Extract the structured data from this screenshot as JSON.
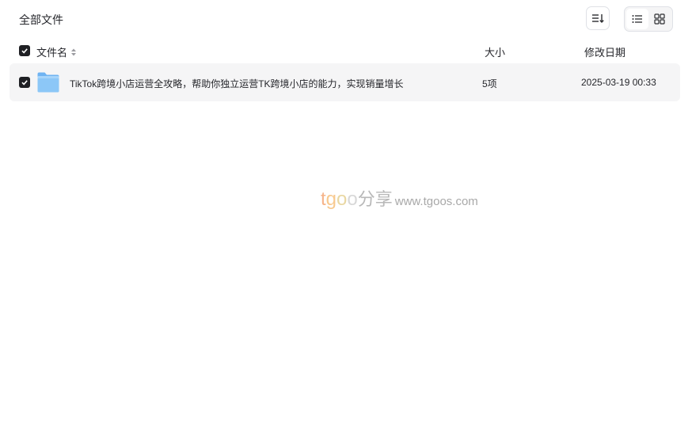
{
  "header": {
    "breadcrumb": "全部文件",
    "sort_icon": "sort-descending-icon",
    "view_modes": [
      {
        "name": "list",
        "icon": "list-view-icon",
        "active": true
      },
      {
        "name": "grid",
        "icon": "grid-view-icon",
        "active": false
      }
    ]
  },
  "columns": {
    "name": "文件名",
    "size": "大小",
    "date": "修改日期"
  },
  "files": [
    {
      "icon": "folder-icon",
      "name": "TikTok跨境小店运营全攻略，帮助你独立运营TK跨境小店的能力，实现销量增长",
      "size": "5项",
      "date": "2025-03-19 00:33",
      "checked": true
    }
  ],
  "watermark": {
    "brand_t": "t",
    "brand_g": "g",
    "brand_o1": "o",
    "brand_o2": "o",
    "brand_cn": "分享",
    "url": "www.tgoos.com"
  },
  "colors": {
    "row_bg": "#f5f5f6",
    "checkbox": "#1f2024",
    "folder": "#7cbcf5"
  }
}
